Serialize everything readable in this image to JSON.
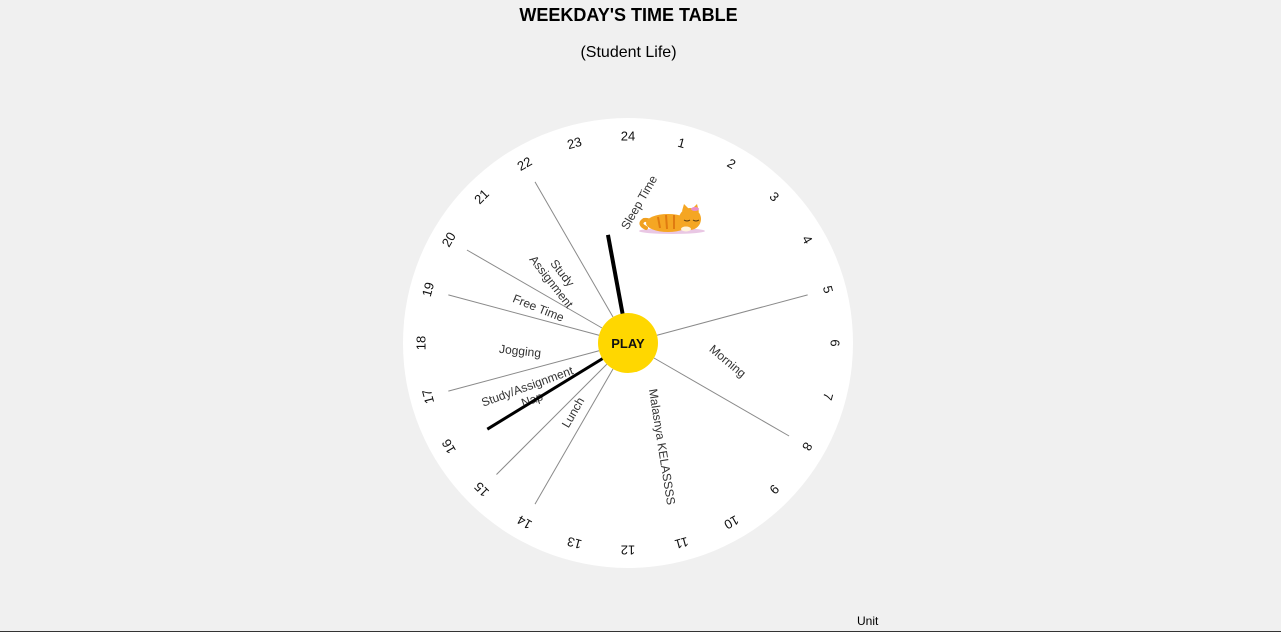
{
  "header": {
    "title": "WEEKDAY'S TIME TABLE",
    "subtitle": "(Student Life)"
  },
  "clock": {
    "hours": [
      "24",
      "1",
      "2",
      "3",
      "4",
      "5",
      "6",
      "7",
      "8",
      "9",
      "10",
      "11",
      "12",
      "13",
      "14",
      "15",
      "16",
      "17",
      "18",
      "19",
      "20",
      "21",
      "22",
      "23"
    ],
    "play_label": "PLAY",
    "play_color": "#ffd700",
    "face_color": "#ffffff",
    "divider_hours": [
      5,
      8,
      14,
      15,
      17,
      19,
      20,
      22
    ],
    "activities": [
      {
        "label": "Sleep Time",
        "lines": [
          "Sleep Time"
        ]
      },
      {
        "label": "Morning",
        "lines": [
          "Morning"
        ]
      },
      {
        "label": "Malasnya KELASSSS",
        "lines": [
          "Malasnya KELASSSS"
        ]
      },
      {
        "label": "Lunch",
        "lines": [
          "Lunch"
        ]
      },
      {
        "label": "Study/Assignment Nap",
        "lines": [
          "Study/Assignment",
          "Nap"
        ]
      },
      {
        "label": "Jogging",
        "lines": [
          "Jogging"
        ]
      },
      {
        "label": "Free Time",
        "lines": [
          "Free Time"
        ]
      },
      {
        "label": "Study Assignment",
        "lines": [
          "Study",
          "Assignment"
        ]
      }
    ],
    "hands": {
      "hour_hand_time": 23.3,
      "minute_hand_time": 15.9
    },
    "sleeping_cat_icon": "sleeping-cat-icon"
  },
  "footer": {
    "unit_label": "Unit"
  }
}
